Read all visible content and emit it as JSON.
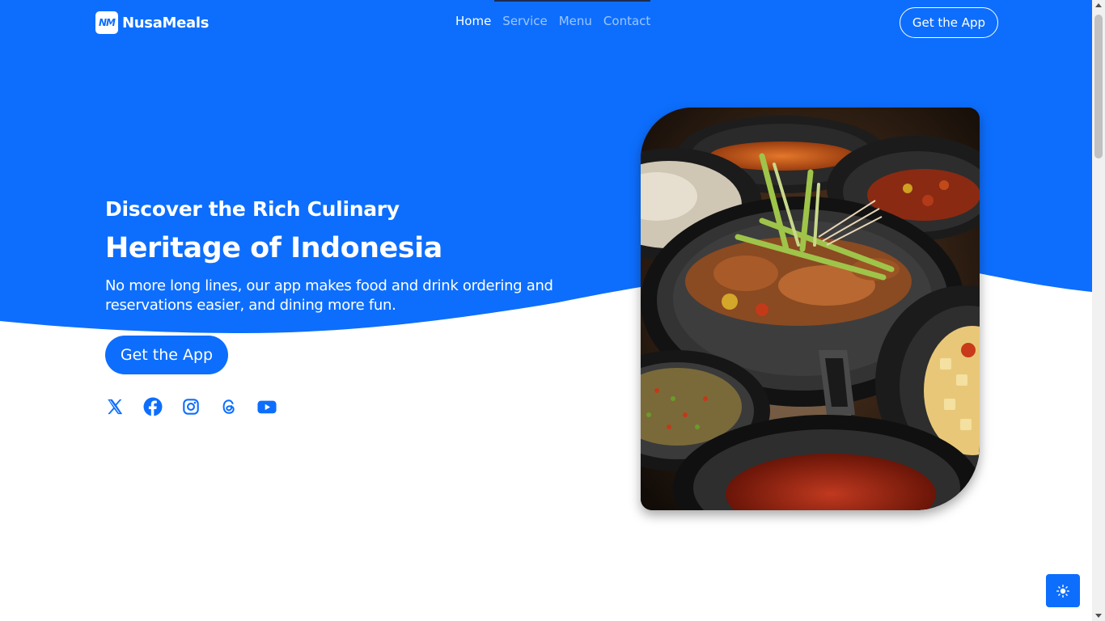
{
  "colors": {
    "primary": "#0d6efd",
    "hero_background": "#0d6efd",
    "text_on_primary": "#ffffff",
    "page_background": "#ffffff"
  },
  "brand": {
    "logo_text": "NM",
    "name": "NusaMeals"
  },
  "nav": {
    "items": [
      {
        "label": "Home",
        "active": true
      },
      {
        "label": "Service",
        "active": false
      },
      {
        "label": "Menu",
        "active": false
      },
      {
        "label": "Contact",
        "active": false
      }
    ],
    "cta_label": "Get the App"
  },
  "hero": {
    "subtitle": "Discover the Rich Culinary",
    "title": "Heritage of Indonesia",
    "description": "No more long lines, our app makes food and drink ordering and reservations easier, and dining more fun.",
    "cta_label": "Get the App",
    "socials": [
      {
        "icon": "x-twitter-icon"
      },
      {
        "icon": "facebook-icon"
      },
      {
        "icon": "instagram-icon"
      },
      {
        "icon": "threads-icon"
      },
      {
        "icon": "youtube-icon"
      }
    ],
    "image_subject": "indonesian-food-pans-photo"
  },
  "theme_toggle": {
    "icon": "sun-icon"
  }
}
